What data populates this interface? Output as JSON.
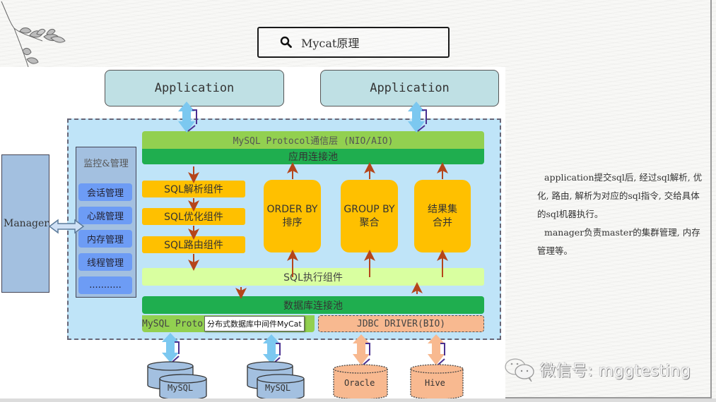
{
  "header": {
    "search_icon": "search-icon",
    "title": "Mycat原理"
  },
  "diagram": {
    "applications": [
      "Application",
      "Application"
    ],
    "manager_label": "Manager",
    "monitor": {
      "title": "监控&管理",
      "items": [
        "会话管理",
        "心跳管理",
        "内存管理",
        "线程管理",
        "..........."
      ]
    },
    "protocol_layer": "MySQL Protocol通信层 (NIO/AIO)",
    "app_connection_pool": "应用连接池",
    "sql_components": [
      "SQL解析组件",
      "SQL优化组件",
      "SQL路由组件"
    ],
    "operations": [
      {
        "line1": "ORDER BY",
        "line2": "排序"
      },
      {
        "line1": "GROUP BY",
        "line2": "聚合"
      },
      {
        "line1": "结果集",
        "line2": "合并"
      }
    ],
    "sql_executor": "SQL执行组件",
    "db_connection_pool": "数据库连接池",
    "mysql_protocol_bottom": "MySQL Proto",
    "tooltip": "分布式数据库中间件MyCat",
    "jdbc_driver": "JDBC DRIVER(BIO)",
    "databases": [
      "MySQL",
      "MySQL",
      "Oracle",
      "Hive"
    ]
  },
  "description": {
    "paragraphs": [
      "application提交sql后, 经过sql解析, 优化, 路由, 解析为对应的sql指令, 交给具体的sql机器执行。",
      "manager负责master的集群管理, 内存管理等。"
    ]
  },
  "watermark": {
    "icon": "wechat-icon",
    "text": "微信号: mggtesting"
  },
  "colors": {
    "app_box": "#bfe0e4",
    "mycat_area": "#bfe4f8",
    "protocol_green": "#92d050",
    "pool_green": "#1fae4f",
    "component_orange": "#ffc000",
    "executor_lime": "#d9ffa0",
    "jdbc_peach": "#f8b990",
    "monitor_item_blue": "#6d9cf5",
    "arrow_brown": "#b5451b",
    "arrow_blue": "#7cc8f0"
  }
}
